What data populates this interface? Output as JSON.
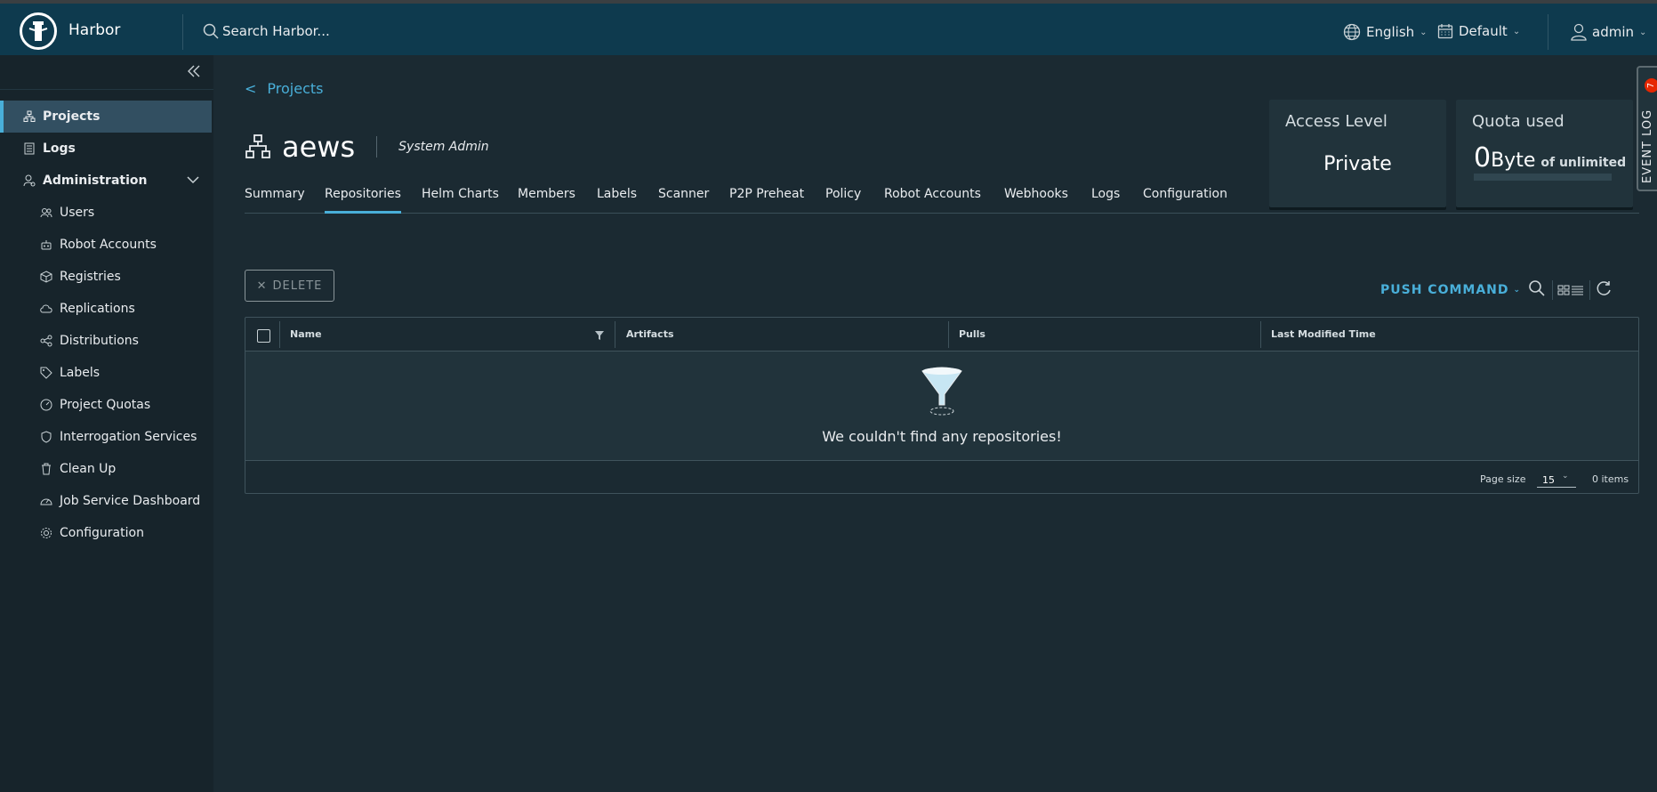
{
  "header": {
    "brand": "Harbor",
    "search_placeholder": "Search Harbor...",
    "language": "English",
    "theme": "Default",
    "user": "admin"
  },
  "sidebar": {
    "items": [
      {
        "label": "Projects",
        "icon": "projects-icon",
        "active": true
      },
      {
        "label": "Logs",
        "icon": "logs-icon"
      },
      {
        "label": "Administration",
        "icon": "administration-icon"
      }
    ],
    "admin_items": [
      {
        "label": "Users",
        "icon": "users-icon"
      },
      {
        "label": "Robot Accounts",
        "icon": "robot-icon"
      },
      {
        "label": "Registries",
        "icon": "registries-icon"
      },
      {
        "label": "Replications",
        "icon": "replications-icon"
      },
      {
        "label": "Distributions",
        "icon": "distributions-icon"
      },
      {
        "label": "Labels",
        "icon": "labels-icon"
      },
      {
        "label": "Project Quotas",
        "icon": "quotas-icon"
      },
      {
        "label": "Interrogation Services",
        "icon": "shield-icon"
      },
      {
        "label": "Clean Up",
        "icon": "trash-icon"
      },
      {
        "label": "Job Service Dashboard",
        "icon": "dashboard-icon"
      },
      {
        "label": "Configuration",
        "icon": "gear-icon"
      }
    ]
  },
  "breadcrumb": {
    "back": "<",
    "label": "Projects"
  },
  "project": {
    "name": "aews",
    "role": "System Admin"
  },
  "cards": {
    "access_title": "Access Level",
    "access_value": "Private",
    "quota_title": "Quota used",
    "quota_num": "0",
    "quota_unit": "Byte",
    "quota_of": "of unlimited",
    "quota_fraction": 0
  },
  "tabs": [
    "Summary",
    "Repositories",
    "Helm Charts",
    "Members",
    "Labels",
    "Scanner",
    "P2P Preheat",
    "Policy",
    "Robot Accounts",
    "Webhooks",
    "Logs",
    "Configuration"
  ],
  "active_tab": "Repositories",
  "toolbar": {
    "delete_label": "DELETE",
    "push_command": "PUSH COMMAND"
  },
  "table": {
    "columns": [
      "Name",
      "Artifacts",
      "Pulls",
      "Last Modified Time"
    ],
    "rows": [],
    "empty_text": "We couldn't find any repositories!",
    "page_size_label": "Page size",
    "page_size": "15",
    "items_count": "0 items"
  },
  "event_log": {
    "label": "EVENT LOG",
    "badge": "7"
  },
  "colors": {
    "accent": "#49afd9",
    "header_bg": "#0e3a4e",
    "page_bg": "#1b2a32",
    "badge": "#e62700"
  }
}
